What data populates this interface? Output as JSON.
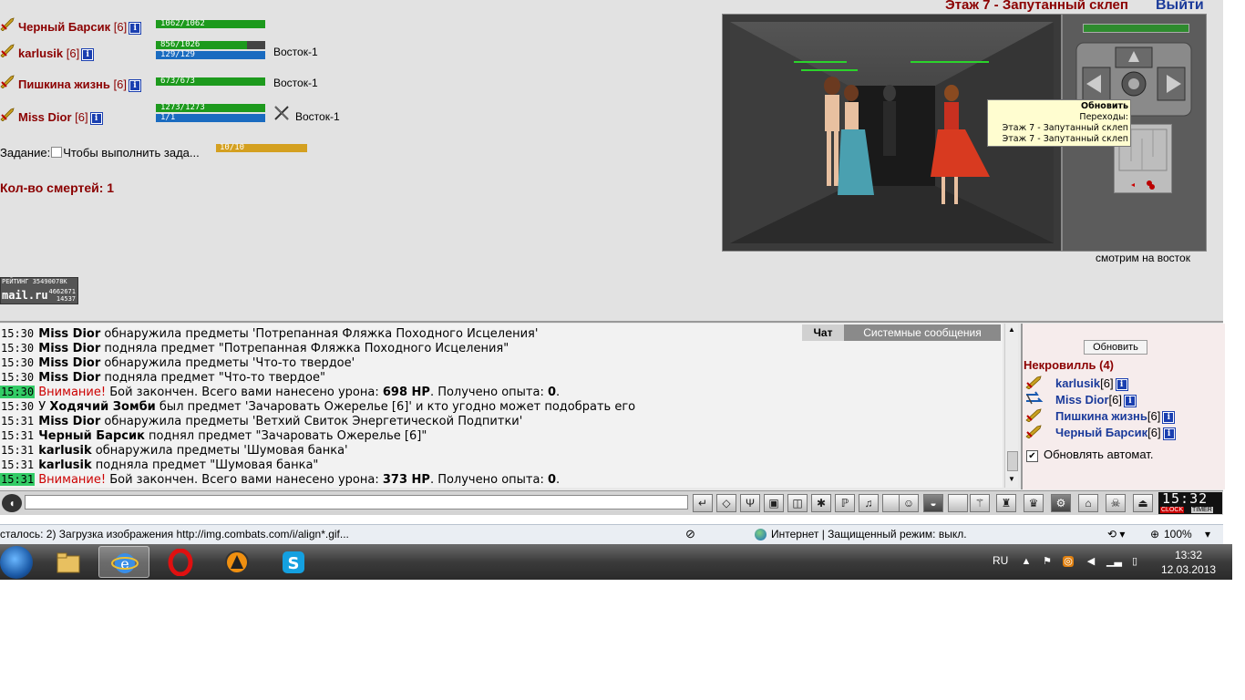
{
  "room": {
    "title": "Этаж 7 - Запутанный склеп",
    "exit_label": "Выйти",
    "view_direction": "смотрим на восток"
  },
  "tooltip": {
    "title": "Обновить",
    "subtitle": "Переходы:",
    "line1": "Этаж 7 - Запутанный склеп",
    "line2": "Этаж 7 - Запутанный склеп"
  },
  "party": [
    {
      "name": "Черный Барсик",
      "level": "[6]",
      "hp": "1062/1062",
      "hp_fraction": 1.0,
      "mp": "",
      "location": ""
    },
    {
      "name": "karlusik",
      "level": "[6]",
      "hp": "856/1026",
      "hp_fraction": 0.834,
      "mp": "129/129",
      "location": "Восток-1"
    },
    {
      "name": "Пишкина жизнь",
      "level": "[6]",
      "hp": "673/673",
      "hp_fraction": 1.0,
      "mp": "",
      "location": "Восток-1"
    },
    {
      "name": "Miss Dior",
      "level": "[6]",
      "hp": "1273/1273",
      "hp_fraction": 1.0,
      "mp": "1/1",
      "location": "Восток-1"
    }
  ],
  "task": {
    "label": "Задание:",
    "text": "Чтобы выполнить зада...",
    "progress": "10/10"
  },
  "deaths": "Кол-во смертей: 1",
  "rating": {
    "label": "РЕЙТИНГ 35490078К",
    "brand": "mail.ru",
    "n1": "4662671",
    "n2": "14537"
  },
  "chat": {
    "tabs": {
      "chat": "Чат",
      "system": "Системные сообщения"
    },
    "messages": [
      {
        "time": "15:30",
        "actor": "Miss Dior",
        "text": " обнаружила предметы 'Потрепанная Фляжка Походного Исцеления'"
      },
      {
        "time": "15:30",
        "actor": "Miss Dior",
        "text": " подняла предмет \"Потрепанная Фляжка Походного Исцеления\""
      },
      {
        "time": "15:30",
        "actor": "Miss Dior",
        "text": " обнаружила предметы 'Что-то твердое'"
      },
      {
        "time": "15:30",
        "actor": "Miss Dior",
        "text": " подняла предмет \"Что-то твердое\""
      },
      {
        "time": "15:30",
        "warn": "Внимание!",
        "text": " Бой закончен. Всего вами нанесено урона: ",
        "dmg": "698 HP",
        "text2": ". Получено опыта: ",
        "exp": "0",
        "text3": "."
      },
      {
        "time": "15:30",
        "pre": "У ",
        "actor": "Ходячий Зомби",
        "text": " был предмет 'Зачаровать Ожерелье [6]' и кто угодно может подобрать его"
      },
      {
        "time": "15:31",
        "actor": "Miss Dior",
        "text": " обнаружила предметы 'Ветхий Свиток Энергетической Подпитки'"
      },
      {
        "time": "15:31",
        "actor": "Черный Барсик",
        "text": " поднял предмет \"Зачаровать Ожерелье [6]\""
      },
      {
        "time": "15:31",
        "actor": "karlusik",
        "text": " обнаружила предметы 'Шумовая банка'"
      },
      {
        "time": "15:31",
        "actor": "karlusik",
        "text": " подняла предмет \"Шумовая банка\""
      },
      {
        "time": "15:31",
        "warn": "Внимание!",
        "text": " Бой закончен. Всего вами нанесено урона: ",
        "dmg": "373 HP",
        "text2": ". Получено опыта: ",
        "exp": "0",
        "text3": "."
      }
    ]
  },
  "location_panel": {
    "refresh_label": "Обновить",
    "title": "Некровилль (4)",
    "players": [
      {
        "name": "karlusik",
        "level": "[6]"
      },
      {
        "name": "Miss Dior",
        "level": "[6]"
      },
      {
        "name": "Пишкина жизнь",
        "level": "[6]"
      },
      {
        "name": "Черный Барсик",
        "level": "[6]"
      }
    ],
    "auto_refresh_label": "Обновлять автомат."
  },
  "clock": {
    "time": "15:32",
    "clock_label": "CLOCK",
    "timer_label": "TIMER"
  },
  "statusbar": {
    "text": "сталось: 2) Загрузка изображения http://img.combats.com/i/align*.gif...",
    "zone": "Интернет | Защищенный режим: выкл.",
    "zoom": "100%"
  },
  "taskbar": {
    "lang": "RU",
    "time": "13:32",
    "date": "12.03.2013"
  }
}
